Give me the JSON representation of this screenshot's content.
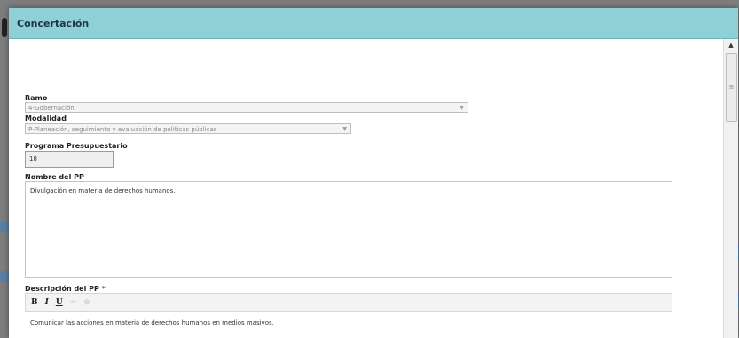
{
  "dialog": {
    "title": "Concertación"
  },
  "form": {
    "ramo": {
      "label": "Ramo",
      "value": "4-Gobernación"
    },
    "modalidad": {
      "label": "Modalidad",
      "value": "P-Planeación, seguimiento y evaluación de políticas públicas"
    },
    "programa": {
      "label": "Programa Presupuestario",
      "value": "18"
    },
    "nombre": {
      "label": "Nombre del PP",
      "value": "Divulgación en materia de derechos humanos."
    },
    "descripcion": {
      "label": "Descripción del PP",
      "required_mark": "*",
      "value": "Comunicar las acciones en materia de derechos humanos en medios masivos."
    }
  },
  "toolbar": {
    "bold": "B",
    "italic": "I",
    "underline": "U",
    "link": "∞",
    "unlink": "⊕"
  },
  "icons": {
    "select_arrow": "chevron-down-icon",
    "scroll_up": "scroll-up-arrow-icon"
  },
  "colors": {
    "header": "#8fcfd6",
    "title": "#1e3448",
    "required": "#d9342b"
  }
}
